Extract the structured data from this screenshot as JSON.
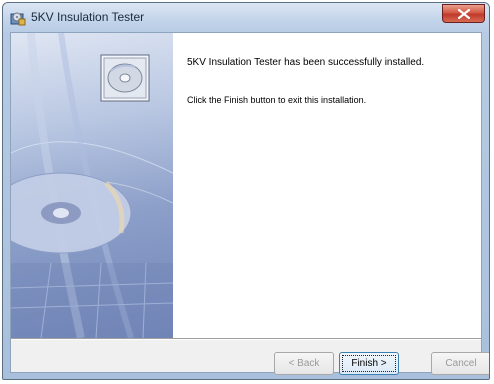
{
  "window": {
    "title": "5KV Insulation Tester"
  },
  "content": {
    "message_primary": "5KV Insulation Tester has been successfully installed.",
    "message_secondary": "Click the Finish button to exit this installation."
  },
  "buttons": {
    "back": {
      "label": "< Back",
      "enabled": false
    },
    "finish": {
      "label": "Finish >",
      "enabled": true,
      "default": true
    },
    "cancel": {
      "label": "Cancel",
      "enabled": false
    }
  },
  "icons": {
    "app": "installer-icon",
    "close": "close-icon",
    "cd": "cd-icon"
  },
  "colors": {
    "close_button": "#c0392b",
    "side_panel": "#7085b8",
    "default_button_border": "#3c7fb1"
  }
}
